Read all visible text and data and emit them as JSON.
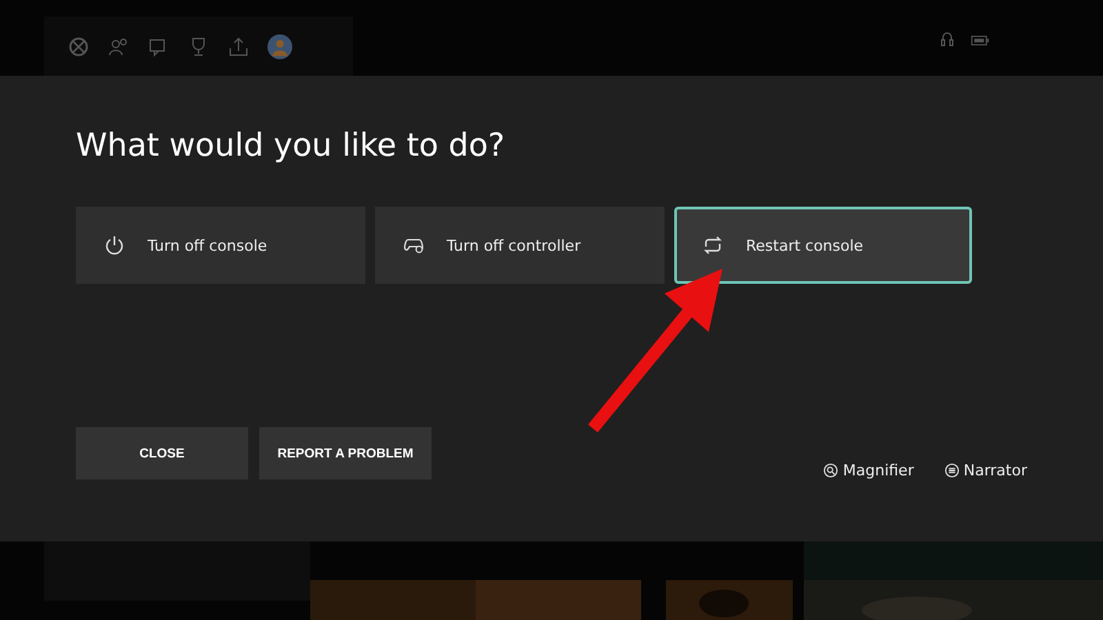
{
  "dialog": {
    "title": "What would you like to do?",
    "options": [
      {
        "label": "Turn off console",
        "kind": "power",
        "selected": false
      },
      {
        "label": "Turn off controller",
        "kind": "controller",
        "selected": false
      },
      {
        "label": "Restart console",
        "kind": "restart",
        "selected": true
      }
    ],
    "buttons": [
      "CLOSE",
      "REPORT A PROBLEM"
    ],
    "accessibility": [
      {
        "label": "Magnifier",
        "kind": "magnifier"
      },
      {
        "label": "Narrator",
        "kind": "narrator"
      }
    ]
  }
}
